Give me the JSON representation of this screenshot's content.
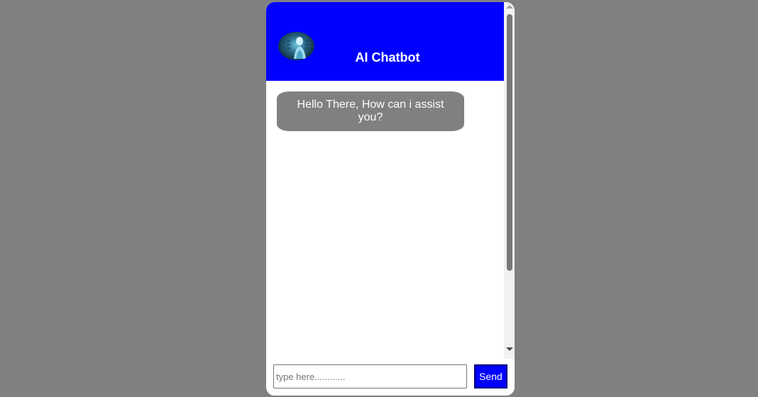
{
  "header": {
    "title": "AI Chatbot",
    "avatar_icon": "robot-avatar-icon"
  },
  "messages": [
    {
      "sender": "bot",
      "text": "Hello There, How can i assist you?"
    }
  ],
  "composer": {
    "placeholder": "type here............",
    "value": "",
    "send_label": "Send"
  },
  "colors": {
    "background": "#808080",
    "header": "#0000ff",
    "bot_bubble": "#808080",
    "send_button": "#0000ff",
    "text_light": "#ffffff"
  }
}
